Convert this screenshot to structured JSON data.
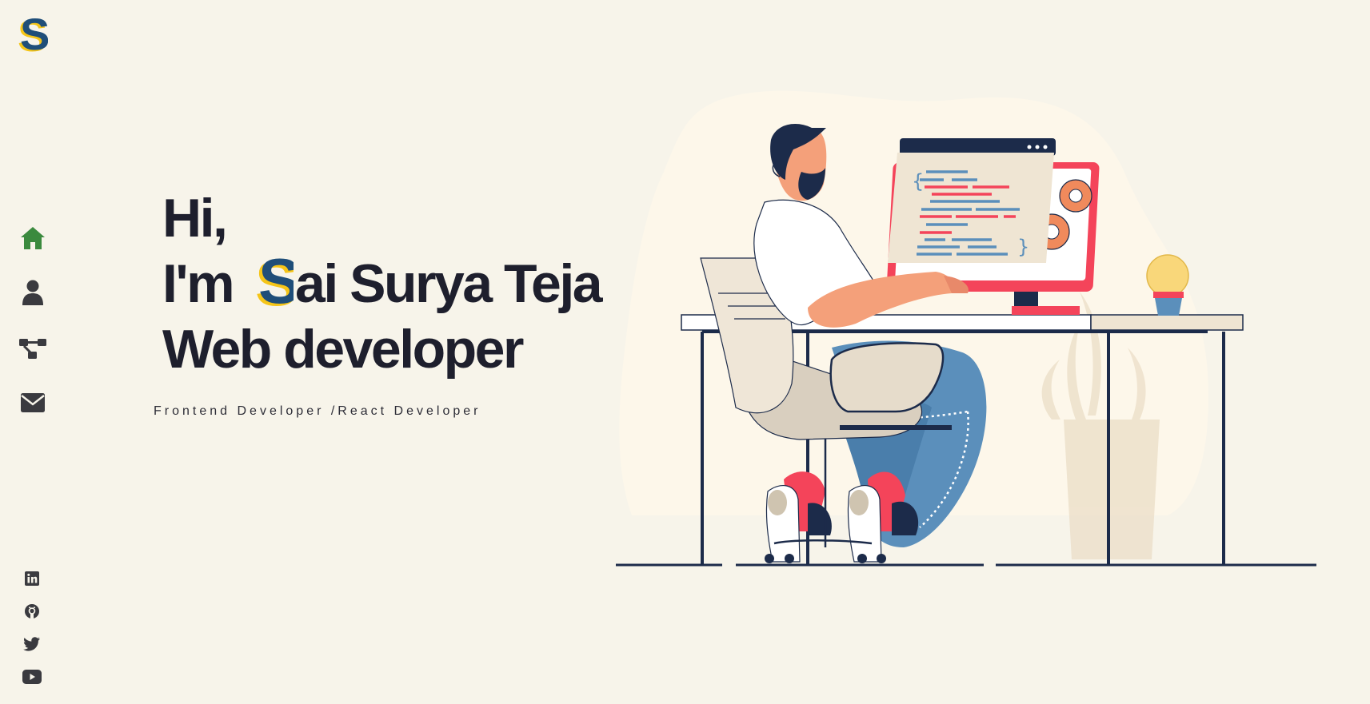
{
  "sidebar": {
    "logo": {
      "icon": "s-logo-icon"
    },
    "nav": [
      {
        "id": "home",
        "icon": "home-icon",
        "active": true,
        "color": "#3b8a3e"
      },
      {
        "id": "about",
        "icon": "user-icon",
        "active": false,
        "color": "#3a3a3f"
      },
      {
        "id": "skills",
        "icon": "network-icon",
        "active": false,
        "color": "#3a3a3f"
      },
      {
        "id": "contact",
        "icon": "envelope-icon",
        "active": false,
        "color": "#3a3a3f"
      }
    ],
    "social": [
      {
        "id": "linkedin",
        "icon": "linkedin-icon"
      },
      {
        "id": "github",
        "icon": "github-icon"
      },
      {
        "id": "twitter",
        "icon": "twitter-icon"
      },
      {
        "id": "youtube",
        "icon": "youtube-icon"
      }
    ]
  },
  "hero": {
    "greeting": "Hi,",
    "intro_prefix": "I'm",
    "name_initial_icon": "s-logo-icon",
    "name_rest": "ai Surya Teja",
    "role": "Web developer",
    "subtitle": "Frontend Developer /React Developer"
  },
  "illustration": {
    "icon": "developer-at-desk-illustration"
  },
  "colors": {
    "background": "#f7f4ea",
    "text": "#1e1f2d",
    "accent_green": "#3b8a3e",
    "logo_blue": "#1f4e79",
    "logo_yellow": "#f5c518",
    "illustration_red": "#f4445a",
    "illustration_blue": "#5b8fbb",
    "illustration_navy": "#1c2b4a"
  }
}
